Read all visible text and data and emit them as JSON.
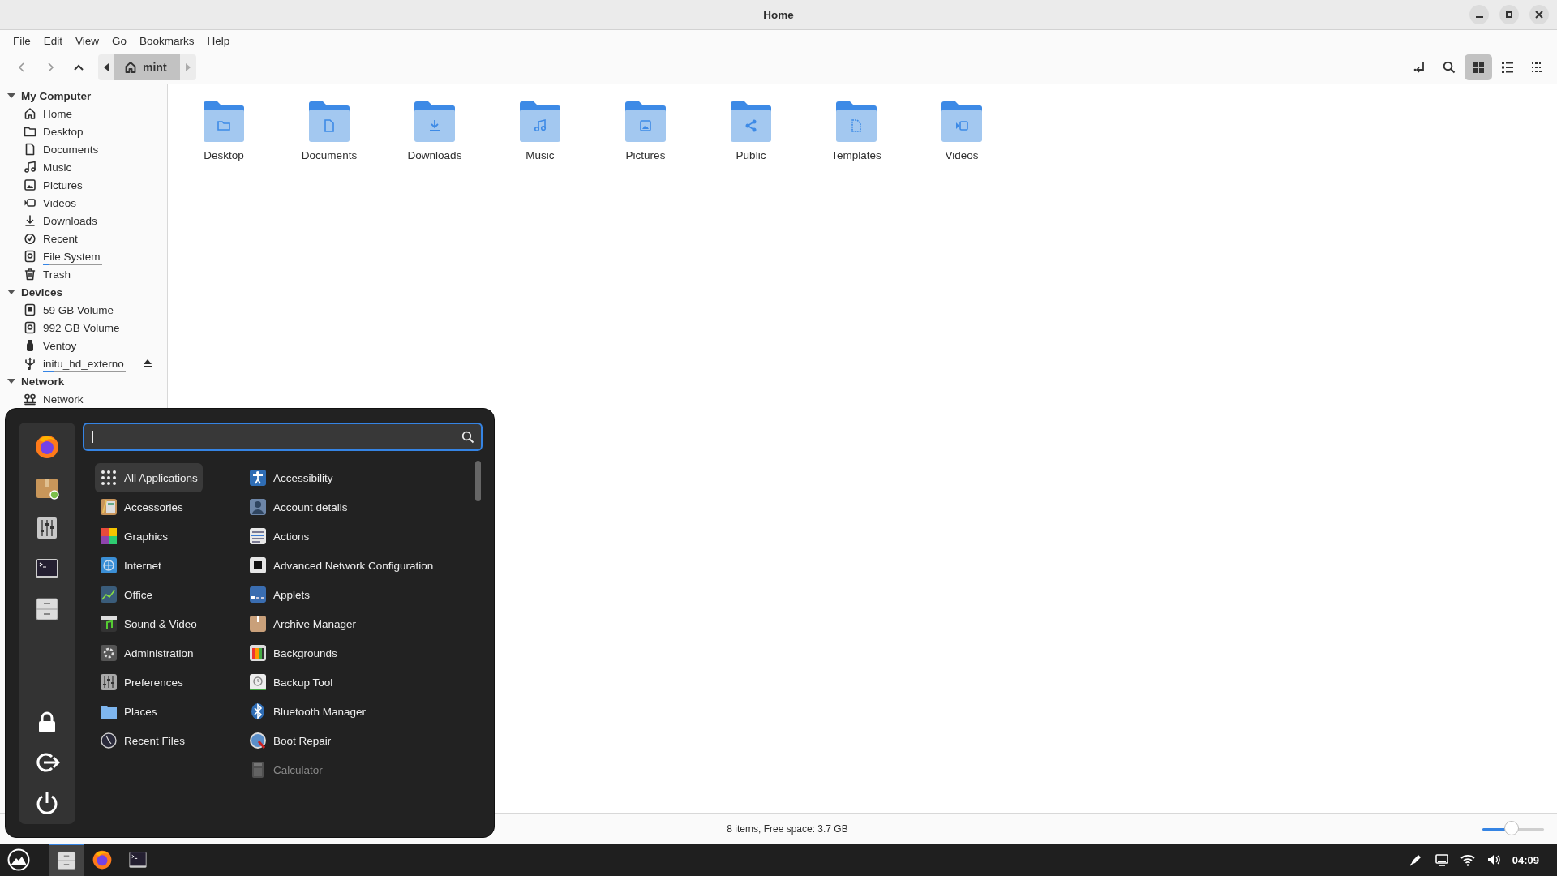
{
  "window": {
    "title": "Home"
  },
  "menubar": [
    "File",
    "Edit",
    "View",
    "Go",
    "Bookmarks",
    "Help"
  ],
  "toolbar": {
    "path": [
      {
        "label": "mint",
        "selected": true
      }
    ],
    "views": [
      {
        "kind": "icons",
        "selected": true
      },
      {
        "kind": "list",
        "selected": false
      },
      {
        "kind": "compact",
        "selected": false
      }
    ]
  },
  "sidebar": {
    "sections": [
      {
        "title": "My Computer",
        "expanded": true,
        "items": [
          {
            "label": "Home"
          },
          {
            "label": "Desktop"
          },
          {
            "label": "Documents"
          },
          {
            "label": "Music"
          },
          {
            "label": "Pictures"
          },
          {
            "label": "Videos"
          },
          {
            "label": "Downloads"
          },
          {
            "label": "Recent"
          },
          {
            "label": "File System",
            "level": 0.1
          },
          {
            "label": "Trash"
          }
        ]
      },
      {
        "title": "Devices",
        "expanded": true,
        "items": [
          {
            "label": "59 GB Volume",
            "ejectable": false
          },
          {
            "label": "992 GB Volume",
            "ejectable": false
          },
          {
            "label": "Ventoy",
            "ejectable": false
          },
          {
            "label": "initu_hd_externo",
            "level": 0.13,
            "ejectable": true
          }
        ]
      },
      {
        "title": "Network",
        "expanded": true,
        "items": [
          {
            "label": "Network"
          }
        ]
      }
    ]
  },
  "content": {
    "folders": [
      {
        "label": "Desktop"
      },
      {
        "label": "Documents"
      },
      {
        "label": "Downloads"
      },
      {
        "label": "Music"
      },
      {
        "label": "Pictures"
      },
      {
        "label": "Public"
      },
      {
        "label": "Templates"
      },
      {
        "label": "Videos"
      }
    ]
  },
  "status_bar": {
    "text": "8 items, Free space: 3.7 GB",
    "zoom": {
      "level": 0.48
    }
  },
  "menu": {
    "categories": [
      {
        "label": "All Applications",
        "selected": true
      },
      {
        "label": "Accessories",
        "selected": false
      },
      {
        "label": "Graphics",
        "selected": false
      },
      {
        "label": "Internet",
        "selected": false
      },
      {
        "label": "Office",
        "selected": false
      },
      {
        "label": "Sound & Video",
        "selected": false
      },
      {
        "label": "Administration",
        "selected": false
      },
      {
        "label": "Preferences",
        "selected": false
      },
      {
        "label": "Places",
        "selected": false
      },
      {
        "label": "Recent Files",
        "selected": false
      }
    ],
    "apps": [
      {
        "label": "Accessibility",
        "dimmed": false
      },
      {
        "label": "Account details",
        "dimmed": false
      },
      {
        "label": "Actions",
        "dimmed": false
      },
      {
        "label": "Advanced Network Configuration",
        "dimmed": false
      },
      {
        "label": "Applets",
        "dimmed": false
      },
      {
        "label": "Archive Manager",
        "dimmed": false
      },
      {
        "label": "Backgrounds",
        "dimmed": false
      },
      {
        "label": "Backup Tool",
        "dimmed": false
      },
      {
        "label": "Bluetooth Manager",
        "dimmed": false
      },
      {
        "label": "Boot Repair",
        "dimmed": false
      },
      {
        "label": "Calculator",
        "dimmed": true
      }
    ]
  },
  "taskbar": {
    "apps": [
      {
        "kind": "files",
        "active": true
      },
      {
        "kind": "browser",
        "active": false
      },
      {
        "kind": "terminal",
        "active": false
      }
    ],
    "clock": "04:09"
  }
}
